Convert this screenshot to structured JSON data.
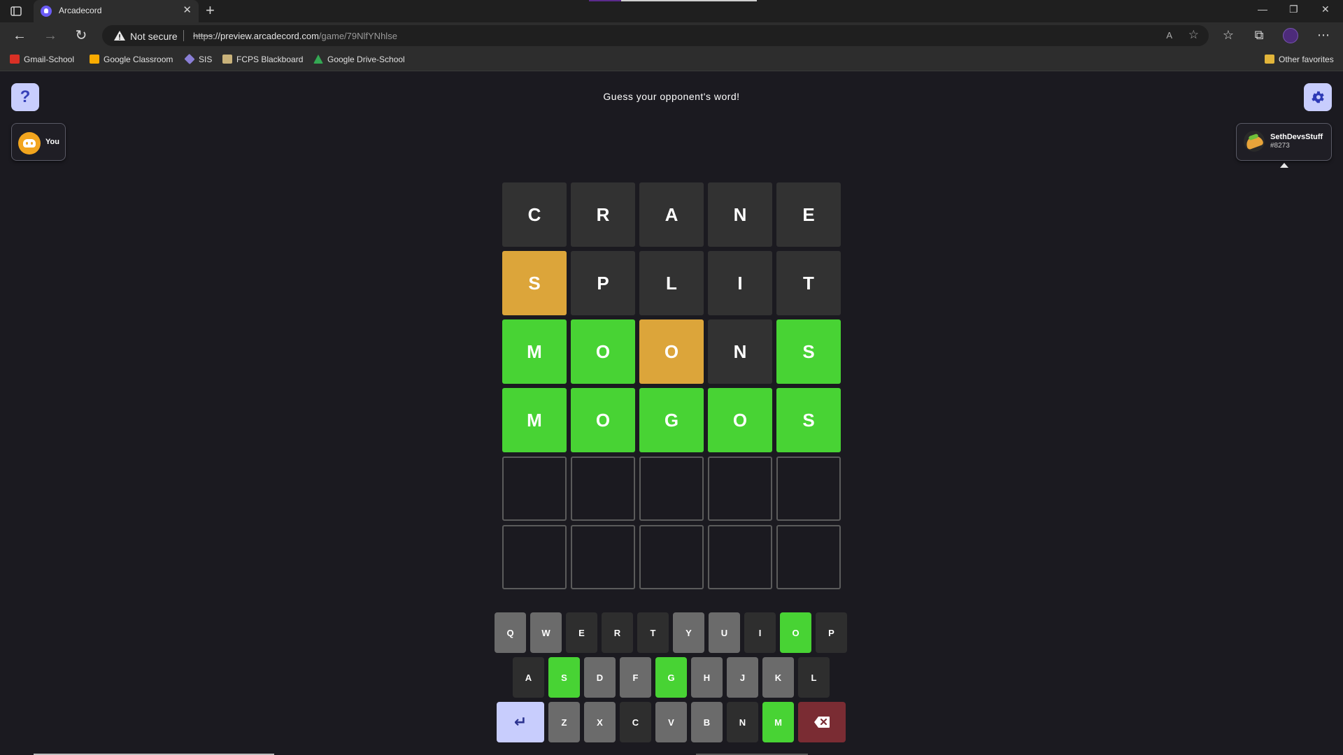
{
  "browser": {
    "tab_title": "Arcadecord",
    "tab_close": "✕",
    "new_tab": "+",
    "window_controls": {
      "minimize": "—",
      "restore": "❐",
      "close": "✕"
    },
    "security_text": "Not secure",
    "url_scheme": "https",
    "url_host": "://preview.arcadecord.com",
    "url_path": "/game/79NlfYNhlse",
    "read_aloud": "A",
    "bookmarks": [
      {
        "label": "Gmail-School",
        "icon_color": "#d93025"
      },
      {
        "label": "Google Classroom",
        "icon_color": "#f9ab00"
      },
      {
        "label": "SIS",
        "icon_color": "#8a7fd6"
      },
      {
        "label": "FCPS Blackboard",
        "icon_color": "#c9b27a"
      },
      {
        "label": "Google Drive-School",
        "icon_color": "#34a853"
      }
    ],
    "other_favorites": "Other favorites"
  },
  "game": {
    "headline": "Guess your opponent's word!",
    "help_label": "?",
    "player": {
      "name": "You"
    },
    "opponent": {
      "name": "SethDevsStuff",
      "tag": "#8273"
    },
    "board": [
      [
        {
          "l": "C",
          "s": "absent"
        },
        {
          "l": "R",
          "s": "absent"
        },
        {
          "l": "A",
          "s": "absent"
        },
        {
          "l": "N",
          "s": "absent"
        },
        {
          "l": "E",
          "s": "absent"
        }
      ],
      [
        {
          "l": "S",
          "s": "present"
        },
        {
          "l": "P",
          "s": "absent"
        },
        {
          "l": "L",
          "s": "absent"
        },
        {
          "l": "I",
          "s": "absent"
        },
        {
          "l": "T",
          "s": "absent"
        }
      ],
      [
        {
          "l": "M",
          "s": "correct"
        },
        {
          "l": "O",
          "s": "correct"
        },
        {
          "l": "O",
          "s": "present"
        },
        {
          "l": "N",
          "s": "absent"
        },
        {
          "l": "S",
          "s": "correct"
        }
      ],
      [
        {
          "l": "M",
          "s": "correct"
        },
        {
          "l": "O",
          "s": "correct"
        },
        {
          "l": "G",
          "s": "correct"
        },
        {
          "l": "O",
          "s": "correct"
        },
        {
          "l": "S",
          "s": "correct"
        }
      ],
      [
        {
          "l": "",
          "s": "empty"
        },
        {
          "l": "",
          "s": "empty"
        },
        {
          "l": "",
          "s": "empty"
        },
        {
          "l": "",
          "s": "empty"
        },
        {
          "l": "",
          "s": "empty"
        }
      ],
      [
        {
          "l": "",
          "s": "empty"
        },
        {
          "l": "",
          "s": "empty"
        },
        {
          "l": "",
          "s": "empty"
        },
        {
          "l": "",
          "s": "empty"
        },
        {
          "l": "",
          "s": "empty"
        }
      ]
    ],
    "keyboard": [
      [
        {
          "k": "Q",
          "s": "unused"
        },
        {
          "k": "W",
          "s": "unused"
        },
        {
          "k": "E",
          "s": "absent"
        },
        {
          "k": "R",
          "s": "absent"
        },
        {
          "k": "T",
          "s": "absent"
        },
        {
          "k": "Y",
          "s": "unused"
        },
        {
          "k": "U",
          "s": "unused"
        },
        {
          "k": "I",
          "s": "absent"
        },
        {
          "k": "O",
          "s": "correct"
        },
        {
          "k": "P",
          "s": "absent"
        }
      ],
      [
        {
          "k": "A",
          "s": "absent"
        },
        {
          "k": "S",
          "s": "correct"
        },
        {
          "k": "D",
          "s": "unused"
        },
        {
          "k": "F",
          "s": "unused"
        },
        {
          "k": "G",
          "s": "correct"
        },
        {
          "k": "H",
          "s": "unused"
        },
        {
          "k": "J",
          "s": "unused"
        },
        {
          "k": "K",
          "s": "unused"
        },
        {
          "k": "L",
          "s": "absent"
        }
      ],
      [
        {
          "k": "↵",
          "s": "enter"
        },
        {
          "k": "Z",
          "s": "unused"
        },
        {
          "k": "X",
          "s": "unused"
        },
        {
          "k": "C",
          "s": "absent"
        },
        {
          "k": "V",
          "s": "unused"
        },
        {
          "k": "B",
          "s": "unused"
        },
        {
          "k": "N",
          "s": "absent"
        },
        {
          "k": "M",
          "s": "correct"
        },
        {
          "k": "",
          "s": "backspace"
        }
      ]
    ],
    "colors": {
      "correct": "#48d334",
      "present": "#dca53a",
      "absent": "#323232",
      "accent": "#c8cdfd"
    }
  }
}
